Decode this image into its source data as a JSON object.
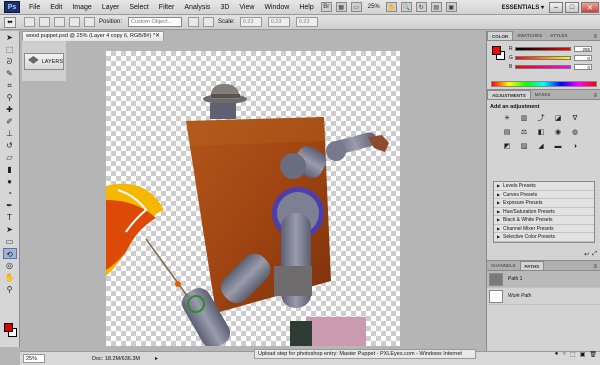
{
  "menubar": {
    "logo": "Ps",
    "items": [
      "File",
      "Edit",
      "Image",
      "Layer",
      "Select",
      "Filter",
      "Analysis",
      "3D",
      "View",
      "Window",
      "Help"
    ],
    "zoom": "25%",
    "workspace": "ESSENTIALS ▾"
  },
  "options": {
    "position_label": "Position:",
    "position_value": "Custom Object...",
    "scale_label": "Scale:",
    "field1": "0.23",
    "field2": "0.23",
    "field3": "0.23"
  },
  "document": {
    "tab_title": "wood puppet.psd @ 25% (Layer 4 copy 6, RGB/8#) *"
  },
  "dock": {
    "layers_label": "LAYERS"
  },
  "status": {
    "zoom": "25%",
    "doc_info": "Doc: 18.2M/636.3M",
    "tooltip": "Upload step for photoshop entry: Master Puppet - PXLEyes.com - Windows Internet"
  },
  "color_panel": {
    "tabs": [
      "COLOR",
      "SWATCHES",
      "STYLES"
    ],
    "r": "255",
    "g": "0",
    "b": "0",
    "labels": [
      "R",
      "G",
      "B"
    ],
    "fg_color": "#ff0000"
  },
  "adjustments": {
    "tabs": [
      "ADJUSTMENTS",
      "MASKS"
    ],
    "title": "Add an adjustment",
    "presets": [
      "Levels Presets",
      "Curves Presets",
      "Exposure Presets",
      "Hue/Saturation Presets",
      "Black & White Presets",
      "Channel Mixer Presets",
      "Selective Color Presets"
    ]
  },
  "paths_panel": {
    "tabs": [
      "CHANNELS",
      "PATHS"
    ],
    "paths": [
      "Path 1",
      "Work Path"
    ]
  },
  "icons": {
    "arrow": "move-tool-icon",
    "brush": "brush-tool-icon"
  }
}
